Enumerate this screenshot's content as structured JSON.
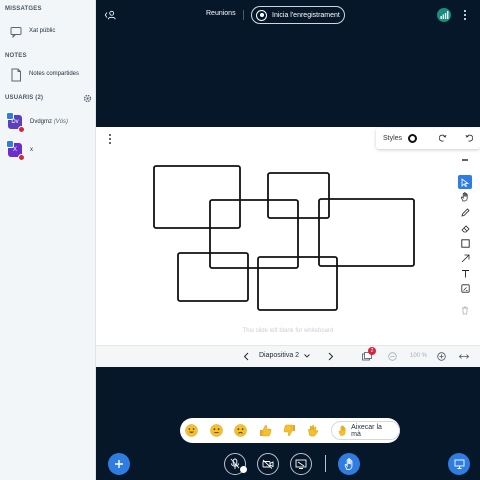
{
  "sidebar": {
    "messages_title": "MISSATGES",
    "public_chat_label": "Xat públic",
    "notes_title": "NOTES",
    "shared_notes_label": "Notes compartides",
    "users_title": "USUARIS (2)",
    "users": [
      {
        "initials": "Dv",
        "name": "Dvdgmz",
        "note": "(Vós)",
        "color": "#5b3fbd"
      },
      {
        "initials": "X",
        "name": "x",
        "note": "",
        "color": "#6a2ecb"
      }
    ]
  },
  "topbar": {
    "meeting_title": "Reunions",
    "record_label": "Inicia l'enregistrament"
  },
  "presentation": {
    "styles_label": "Styles",
    "caption": "This slide left blank for whiteboard",
    "slide_label": "Diapositiva 2",
    "zoom": "100 %",
    "notification_count": "2"
  },
  "reactions": {
    "lower_hand_label": "Aixecar la mà"
  },
  "colors": {
    "background": "#06172a",
    "accent": "#2f7de1",
    "danger": "#d6243d",
    "connection": "#1b8c80"
  },
  "icons": [
    "chevron-left-icon",
    "user-icon",
    "chat-icon",
    "notes-icon",
    "gear-icon",
    "signal-icon",
    "kebab-icon",
    "redo-icon",
    "undo-icon",
    "pointer-icon",
    "hand-icon",
    "pencil-icon",
    "eraser-icon",
    "rectangle-icon",
    "arrow-icon",
    "text-icon",
    "note-icon",
    "trash-icon",
    "plus-icon",
    "microphone-icon",
    "camera-icon",
    "screenshare-icon",
    "raise-hand-icon",
    "presentation-icon"
  ]
}
